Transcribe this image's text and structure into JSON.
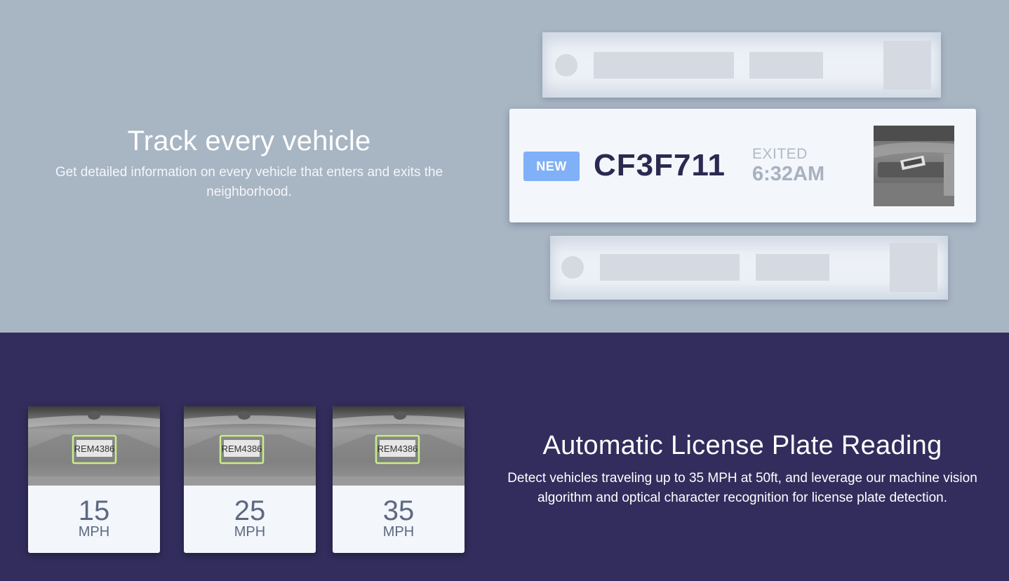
{
  "tracking": {
    "title": "Track every vehicle",
    "description": "Get detailed information on every vehicle that enters and exits the neighborhood."
  },
  "vehicle_card": {
    "badge": "NEW",
    "plate": "CF3F711",
    "status": "EXITED",
    "time": "6:32AM"
  },
  "alpr": {
    "title": "Automatic License Plate Reading",
    "description": "Detect vehicles traveling up to 35 MPH at 50ft, and leverage our machine vision algorithm and optical character recognition for license plate detection."
  },
  "speed_cards": [
    {
      "speed": "15",
      "unit": "MPH",
      "plate": "REM4386"
    },
    {
      "speed": "25",
      "unit": "MPH",
      "plate": "REM4386"
    },
    {
      "speed": "35",
      "unit": "MPH",
      "plate": "REM4386"
    }
  ],
  "colors": {
    "top_background": "#a8b5c3",
    "bottom_background": "#322d5c",
    "badge": "#7fb0f8",
    "plate_text": "#2c2950",
    "plate_highlight": "#c8ee8a"
  }
}
